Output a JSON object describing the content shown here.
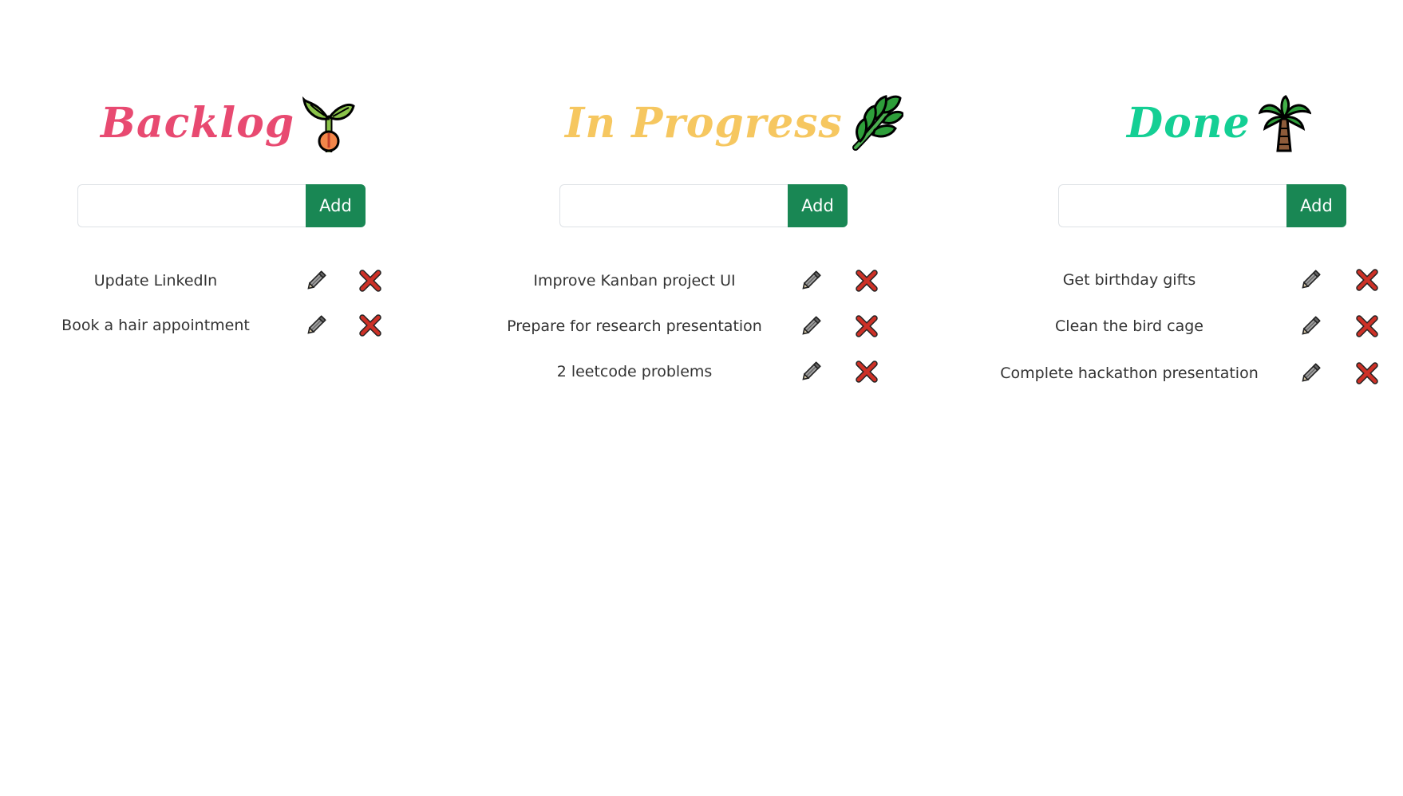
{
  "colors": {
    "backlog_title": "#e84a71",
    "in_progress_title": "#f6c760",
    "done_title": "#14cf94",
    "add_button_bg": "#198754",
    "delete_icon": "#cd3127"
  },
  "icons": {
    "backlog": "seedling-icon",
    "in_progress": "herb-icon",
    "done": "palm-tree-icon",
    "edit": "pencil-icon",
    "delete": "cross-mark-icon"
  },
  "columns": {
    "backlog": {
      "title": "Backlog",
      "input_value": "",
      "add_label": "Add",
      "tasks": [
        "Update LinkedIn",
        "Book a hair appointment"
      ]
    },
    "in_progress": {
      "title": "In Progress",
      "input_value": "",
      "add_label": "Add",
      "tasks": [
        "Improve Kanban project UI",
        "Prepare for research presentation",
        "2 leetcode problems"
      ]
    },
    "done": {
      "title": "Done",
      "input_value": "",
      "add_label": "Add",
      "tasks": [
        "Get birthday gifts",
        "Clean the bird cage",
        "Complete hackathon presentation"
      ]
    }
  }
}
